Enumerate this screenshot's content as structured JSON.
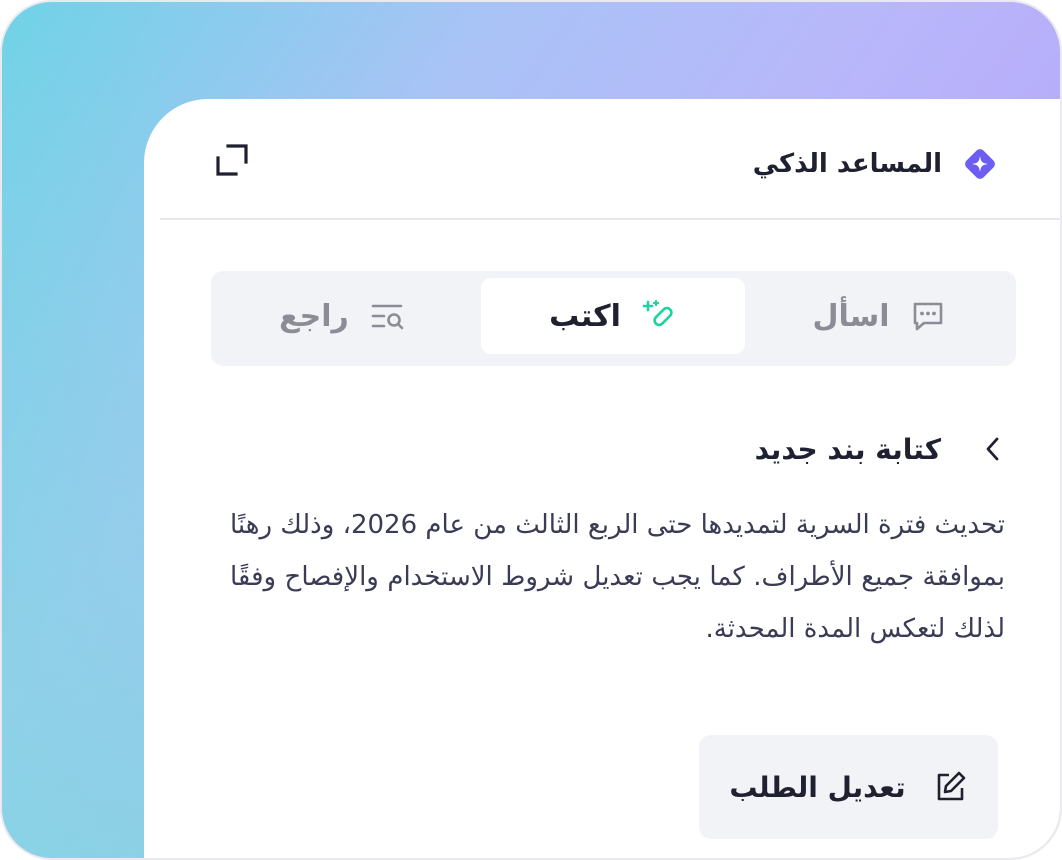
{
  "header": {
    "title": "المساعد الذكي",
    "accent_color": "#6d5df2",
    "title_icon": "sparkle-diamond-icon",
    "expand_icon": "expand-icon"
  },
  "tabs": [
    {
      "label": "اسأل",
      "icon": "chat-bubble-icon",
      "active": false
    },
    {
      "label": "اكتب",
      "icon": "magic-pen-icon",
      "active": true
    },
    {
      "label": "راجع",
      "icon": "list-search-icon",
      "active": false
    }
  ],
  "section": {
    "title": "كتابة بند جديد",
    "icon": "chevron-left-icon"
  },
  "generated_text": "تحديث فترة السرية لتمديدها حتى الربع الثالث من عام 2026، وذلك رهنًا بموافقة جميع الأطراف. كما يجب تعديل شروط الاستخدام والإفصاح وفقًا لذلك لتعكس المدة المحدثة.",
  "actions": {
    "edit_request_label": "تعديل الطلب",
    "edit_icon": "edit-icon"
  },
  "colors": {
    "write_accent": "#1fd3a0",
    "text_primary": "#1f2030",
    "text_muted": "#8b8c95"
  }
}
